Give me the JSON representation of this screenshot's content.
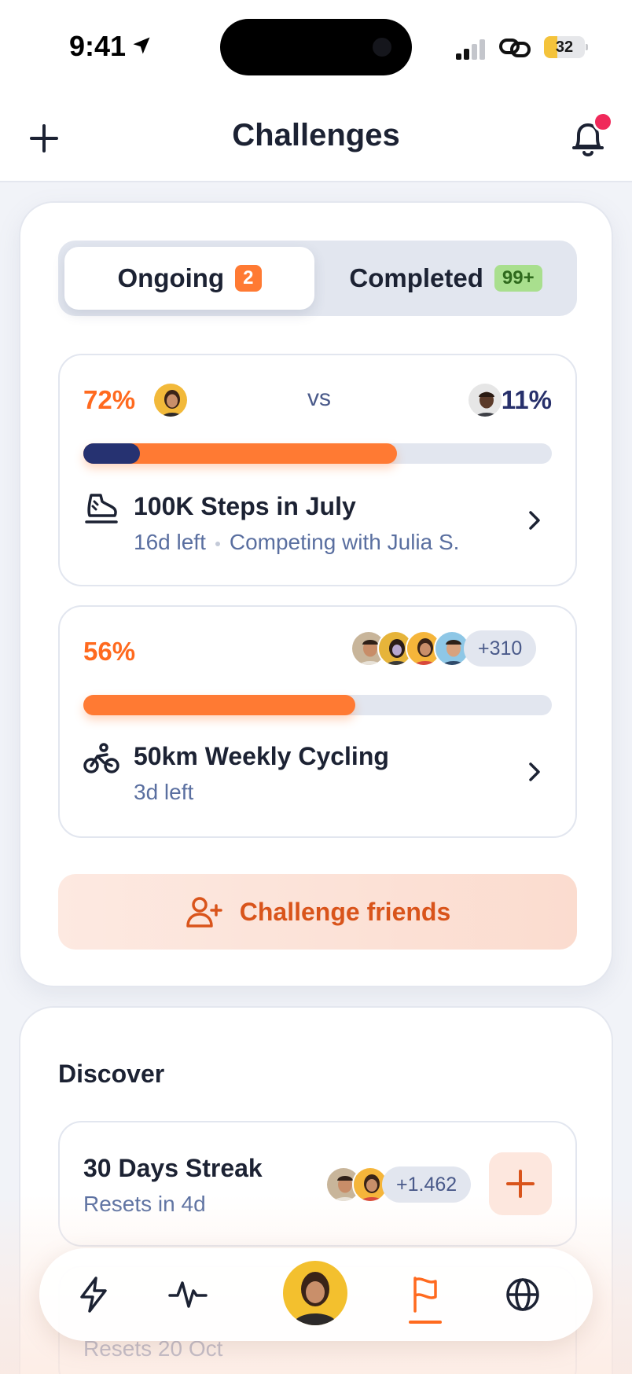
{
  "status_bar": {
    "time": "9:41",
    "battery": "32",
    "battery_level": 0.32
  },
  "header": {
    "title": "Challenges"
  },
  "tabs": {
    "ongoing_label": "Ongoing",
    "ongoing_count": "2",
    "completed_label": "Completed",
    "completed_count": "99+"
  },
  "challenges": [
    {
      "my_pct": "72%",
      "vs": "vs",
      "opp_pct": "11%",
      "progress": 0.67,
      "opponent_progress": 0.12,
      "title": "100K Steps in July",
      "time_left": "16d left",
      "detail": "Competing with Julia S.",
      "icon": "shoe-icon"
    },
    {
      "my_pct": "56%",
      "progress": 0.58,
      "participants_more": "+310",
      "title": "50km Weekly Cycling",
      "time_left": "3d left",
      "icon": "bike-icon"
    }
  ],
  "cta": {
    "label": "Challenge friends"
  },
  "discover": {
    "title": "Discover",
    "items": [
      {
        "title": "30 Days Streak",
        "sub": "Resets in 4d",
        "more": "+1.462"
      },
      {
        "title": "",
        "sub": "Resets 20 Oct",
        "more": ""
      }
    ]
  },
  "colors": {
    "accent": "#ff6a1f",
    "navy": "#263271",
    "notification": "#f0295a"
  }
}
